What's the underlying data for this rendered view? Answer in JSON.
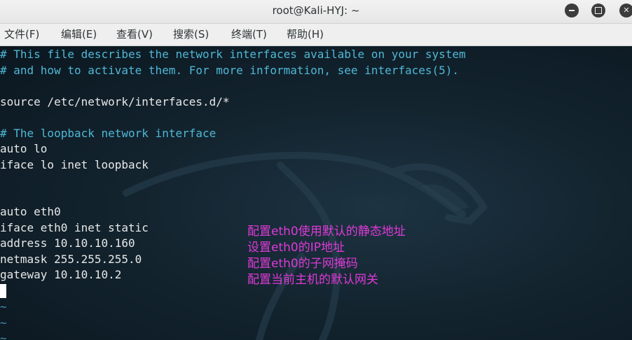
{
  "window": {
    "title": "root@Kali-HYJ: ~"
  },
  "window_controls": {
    "minimize_icon": "minimize-icon",
    "maximize_icon": "maximize-icon",
    "close_icon": "close-icon"
  },
  "menu": {
    "file": "文件(F)",
    "edit": "编辑(E)",
    "view": "查看(V)",
    "search": "搜索(S)",
    "terminal": "终端(T)",
    "help": "帮助(H)"
  },
  "terminal": {
    "lines": [
      "# This file describes the network interfaces available on your system",
      "# and how to activate them. For more information, see interfaces(5).",
      "",
      "source /etc/network/interfaces.d/*",
      "",
      "# The loopback network interface",
      "auto lo",
      "iface lo inet loopback",
      "",
      "",
      "auto eth0",
      "iface eth0 inet static",
      "address 10.10.10.160",
      "netmask 255.255.255.0",
      "gateway 10.10.10.2"
    ],
    "tildes": [
      "~",
      "~",
      "~"
    ]
  },
  "annotations": [
    "配置eth0使用默认的静态地址",
    "设置eth0的IP地址",
    "配置eth0的子网掩码",
    "配置当前主机的默认网关"
  ],
  "colors": {
    "comment": "#4fb8d6",
    "text": "#e8e8e8",
    "annotation": "#e03ad8",
    "background": "#13242f"
  }
}
